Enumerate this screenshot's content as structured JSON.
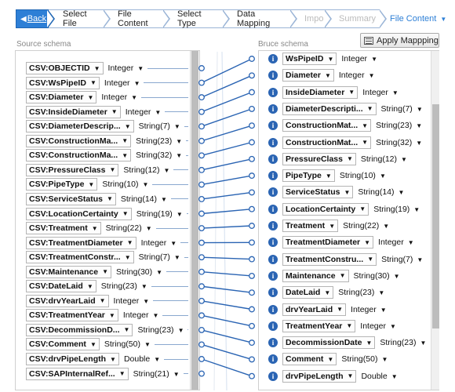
{
  "wizard": {
    "back_label": "Back",
    "steps": [
      {
        "label": "Select File",
        "disabled": false
      },
      {
        "label": "File Content",
        "disabled": false
      },
      {
        "label": "Select Type",
        "disabled": false
      },
      {
        "label": "Data Mapping",
        "disabled": false
      },
      {
        "label": "Import",
        "disabled": true
      },
      {
        "label": "Summary",
        "disabled": true
      }
    ],
    "menu_label": "File Content"
  },
  "source": {
    "title": "Source schema",
    "fields": [
      {
        "name": "CSV:OBJECTID",
        "type": "Integer"
      },
      {
        "name": "CSV:WsPipeID",
        "type": "Integer"
      },
      {
        "name": "CSV:Diameter",
        "type": "Integer"
      },
      {
        "name": "CSV:InsideDiameter",
        "type": "Integer"
      },
      {
        "name": "CSV:DiameterDescrip...",
        "type": "String(7)"
      },
      {
        "name": "CSV:ConstructionMa...",
        "type": "String(23)"
      },
      {
        "name": "CSV:ConstructionMa...",
        "type": "String(32)"
      },
      {
        "name": "CSV:PressureClass",
        "type": "String(12)"
      },
      {
        "name": "CSV:PipeType",
        "type": "String(10)"
      },
      {
        "name": "CSV:ServiceStatus",
        "type": "String(14)"
      },
      {
        "name": "CSV:LocationCertainty",
        "type": "String(19)"
      },
      {
        "name": "CSV:Treatment",
        "type": "String(22)"
      },
      {
        "name": "CSV:TreatmentDiameter",
        "type": "Integer"
      },
      {
        "name": "CSV:TreatmentConstr...",
        "type": "String(7)"
      },
      {
        "name": "CSV:Maintenance",
        "type": "String(30)"
      },
      {
        "name": "CSV:DateLaid",
        "type": "String(23)"
      },
      {
        "name": "CSV:drvYearLaid",
        "type": "Integer"
      },
      {
        "name": "CSV:TreatmentYear",
        "type": "Integer"
      },
      {
        "name": "CSV:DecommissionD...",
        "type": "String(23)"
      },
      {
        "name": "CSV:Comment",
        "type": "String(50)"
      },
      {
        "name": "CSV:drvPipeLength",
        "type": "Double"
      },
      {
        "name": "CSV:SAPInternalRef...",
        "type": "String(21)"
      }
    ]
  },
  "destination": {
    "title": "Bruce schema",
    "apply_label": "Apply Mappping",
    "fields": [
      {
        "name": "WsPipeID",
        "type": "Integer"
      },
      {
        "name": "Diameter",
        "type": "Integer"
      },
      {
        "name": "InsideDiameter",
        "type": "Integer"
      },
      {
        "name": "DiameterDescripti...",
        "type": "String(7)"
      },
      {
        "name": "ConstructionMat...",
        "type": "String(23)"
      },
      {
        "name": "ConstructionMat...",
        "type": "String(32)"
      },
      {
        "name": "PressureClass",
        "type": "String(12)"
      },
      {
        "name": "PipeType",
        "type": "String(10)"
      },
      {
        "name": "ServiceStatus",
        "type": "String(14)"
      },
      {
        "name": "LocationCertainty",
        "type": "String(19)"
      },
      {
        "name": "Treatment",
        "type": "String(22)"
      },
      {
        "name": "TreatmentDiameter",
        "type": "Integer"
      },
      {
        "name": "TreatmentConstru...",
        "type": "String(7)"
      },
      {
        "name": "Maintenance",
        "type": "String(30)"
      },
      {
        "name": "DateLaid",
        "type": "String(23)"
      },
      {
        "name": "drvYearLaid",
        "type": "Integer"
      },
      {
        "name": "TreatmentYear",
        "type": "Integer"
      },
      {
        "name": "DecommissionDate",
        "type": "String(23)"
      },
      {
        "name": "Comment",
        "type": "String(50)"
      },
      {
        "name": "drvPipeLength",
        "type": "Double"
      }
    ]
  },
  "colors": {
    "accent": "#2d7fd6",
    "link": "#2a64b3",
    "info": "#2a64b3"
  },
  "icons": {
    "back": "left-arrow-icon",
    "info": "info-icon",
    "apply": "list-icon",
    "dropdown": "caret-down-icon"
  }
}
